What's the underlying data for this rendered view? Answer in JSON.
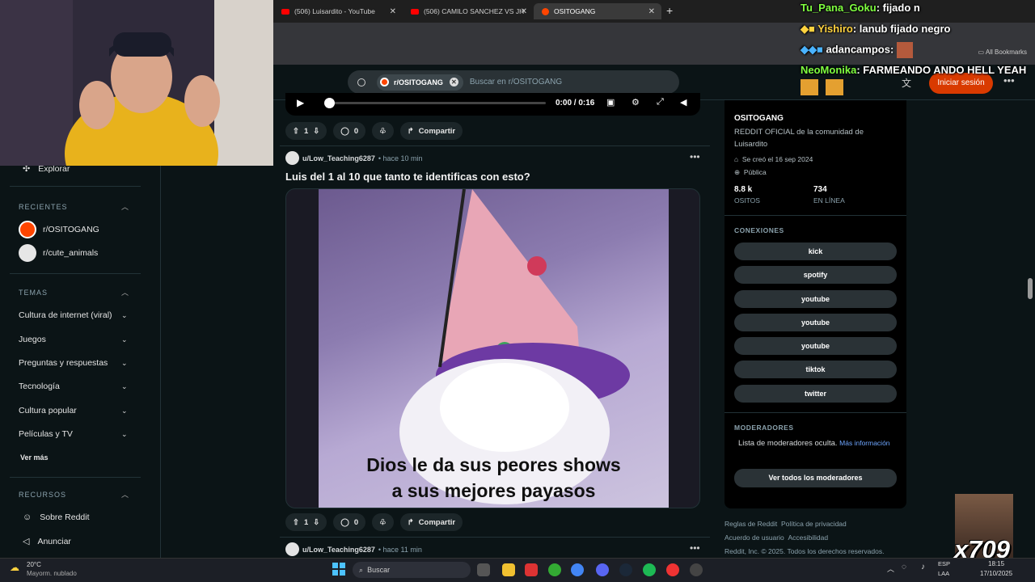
{
  "browser": {
    "tabs": [
      {
        "label": "(506) Luisardito - YouTube",
        "icon": "youtube-icon"
      },
      {
        "label": "(506) CAMILO SANCHEZ VS JH",
        "icon": "youtube-icon"
      },
      {
        "label": "OSITOGANG",
        "icon": "reddit-icon"
      }
    ],
    "bookmarks_label": "All Bookmarks"
  },
  "header": {
    "community_chip": "r/OSITOGANG",
    "search_placeholder": "Buscar en r/OSITOGANG",
    "login_label": "Iniciar sesión"
  },
  "sidebar": {
    "explore_label": "Explorar",
    "recent_title": "RECIENTES",
    "recent": [
      {
        "label": "r/OSITOGANG"
      },
      {
        "label": "r/cute_animals"
      }
    ],
    "topics_title": "TEMAS",
    "topics": [
      {
        "label": "Cultura de internet (viral)"
      },
      {
        "label": "Juegos"
      },
      {
        "label": "Preguntas y respuestas"
      },
      {
        "label": "Tecnología"
      },
      {
        "label": "Cultura popular"
      },
      {
        "label": "Películas y TV"
      }
    ],
    "see_more": "Ver más",
    "resources_title": "RECURSOS",
    "resources": [
      {
        "label": "Sobre Reddit",
        "icon": "reddit-alien-icon"
      },
      {
        "label": "Anunciar",
        "icon": "megaphone-icon"
      }
    ]
  },
  "video": {
    "time": "0:00 / 0:16",
    "progress": 0.02
  },
  "posts": [
    {
      "upvotes": "1",
      "comments": "0",
      "share": "Compartir"
    },
    {
      "user": "u/Low_Teaching6287",
      "time": "hace 10 min",
      "title": "Luis del 1 al 10 que tanto te identificas con esto?",
      "caption_line1": "Dios le da sus peores shows",
      "caption_line2": "a sus mejores payasos",
      "upvotes": "1",
      "comments": "0",
      "share": "Compartir"
    },
    {
      "user": "u/Low_Teaching6287",
      "time": "hace 11 min"
    }
  ],
  "community": {
    "name": "OSITOGANG",
    "description": "REDDIT OFICIAL de la comunidad de Luisardito",
    "created": "Se creó el 16 sep 2024",
    "visibility": "Pública",
    "members_value": "8.8 k",
    "members_label": "OSITOS",
    "online_value": "734",
    "online_label": "EN LÍNEA",
    "connections_title": "CONEXIONES",
    "connections": [
      "kick",
      "spotify",
      "youtube",
      "youtube",
      "youtube",
      "tiktok",
      "twitter"
    ],
    "moderators_title": "MODERADORES",
    "moderators_text": "Lista de moderadores oculta.",
    "moderators_link": "Más información",
    "moderators_button": "Ver todos los moderadores"
  },
  "footer": {
    "line1a": "Reglas de Reddit",
    "line1b": "Política de privacidad",
    "line2a": "Acuerdo de usuario",
    "line2b": "Accesibilidad",
    "line3": "Reddit, Inc. © 2025. Todos los derechos reservados."
  },
  "chat": [
    {
      "user": "Tu_Pana_Goku",
      "msg": ": fijado n",
      "color": "#7fff3f"
    },
    {
      "user": "Yishiro",
      "msg": ": lanub fijado negro",
      "color": "#ffd23f"
    },
    {
      "user": "adancampos",
      "msg": ":",
      "color": "#ffffff"
    },
    {
      "user": "NeoMonika",
      "msg": ": FARMEANDO ANDO HELL YEAH",
      "color": "#7fff3f"
    }
  ],
  "overlay_badge": "x709",
  "taskbar": {
    "weather_temp": "20°C",
    "weather_desc": "Mayorm. nublado",
    "search_placeholder": "Buscar",
    "lang1": "ESP",
    "lang2": "LAA",
    "time": "18:15",
    "date": "17/10/2025"
  },
  "colors": {
    "reddit_orange": "#ff4500",
    "login_button": "#d93a00",
    "background": "#0b1416"
  }
}
